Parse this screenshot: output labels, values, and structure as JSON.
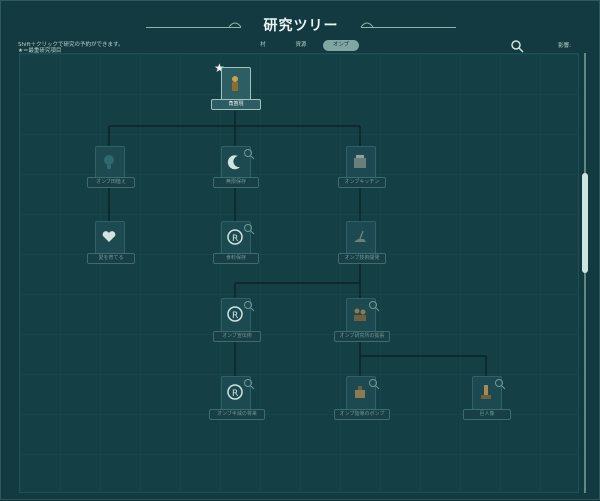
{
  "header": {
    "title": "研究ツリー",
    "hint_lines": [
      "Shift＋クリックで研究の予約ができます。",
      "★＝最重研究項目"
    ]
  },
  "tabs": [
    {
      "label": "村",
      "active": false
    },
    {
      "label": "資源",
      "active": false
    },
    {
      "label": "オンブ",
      "active": true
    }
  ],
  "points": {
    "label": "影響:",
    "value": "0"
  },
  "tree": {
    "root": {
      "label": "角笛現",
      "icon": "horn-figure-icon",
      "starred": true
    },
    "row1": [
      {
        "label": "オンブ田植え",
        "icon": "balloon-icon"
      },
      {
        "label": "無限保存",
        "icon": "moon-icon"
      },
      {
        "label": "オンブキッチン",
        "icon": "kitchen-icon"
      }
    ],
    "row2": [
      {
        "label": "愛を育てる",
        "icon": "heart-plant-icon"
      },
      {
        "label": "食料保存",
        "icon": "coin-icon"
      },
      {
        "label": "オンブ技術開発",
        "icon": "shovel-icon"
      }
    ],
    "row3": [
      {
        "label": "オンブ宣伝術",
        "icon": "coin-icon"
      },
      {
        "label": "オンブ研究所の拡張",
        "icon": "workers-icon"
      }
    ],
    "row4": [
      {
        "label": "オンブ半減の将来",
        "icon": "coin-icon"
      },
      {
        "label": "オンブ指導のポンプ",
        "icon": "pump-icon"
      },
      {
        "label": "巨人像",
        "icon": "statue-icon"
      }
    ]
  },
  "colors": {
    "background": "#123a40",
    "active_tab": "#7fa6a2",
    "line": "#0a1e21"
  }
}
